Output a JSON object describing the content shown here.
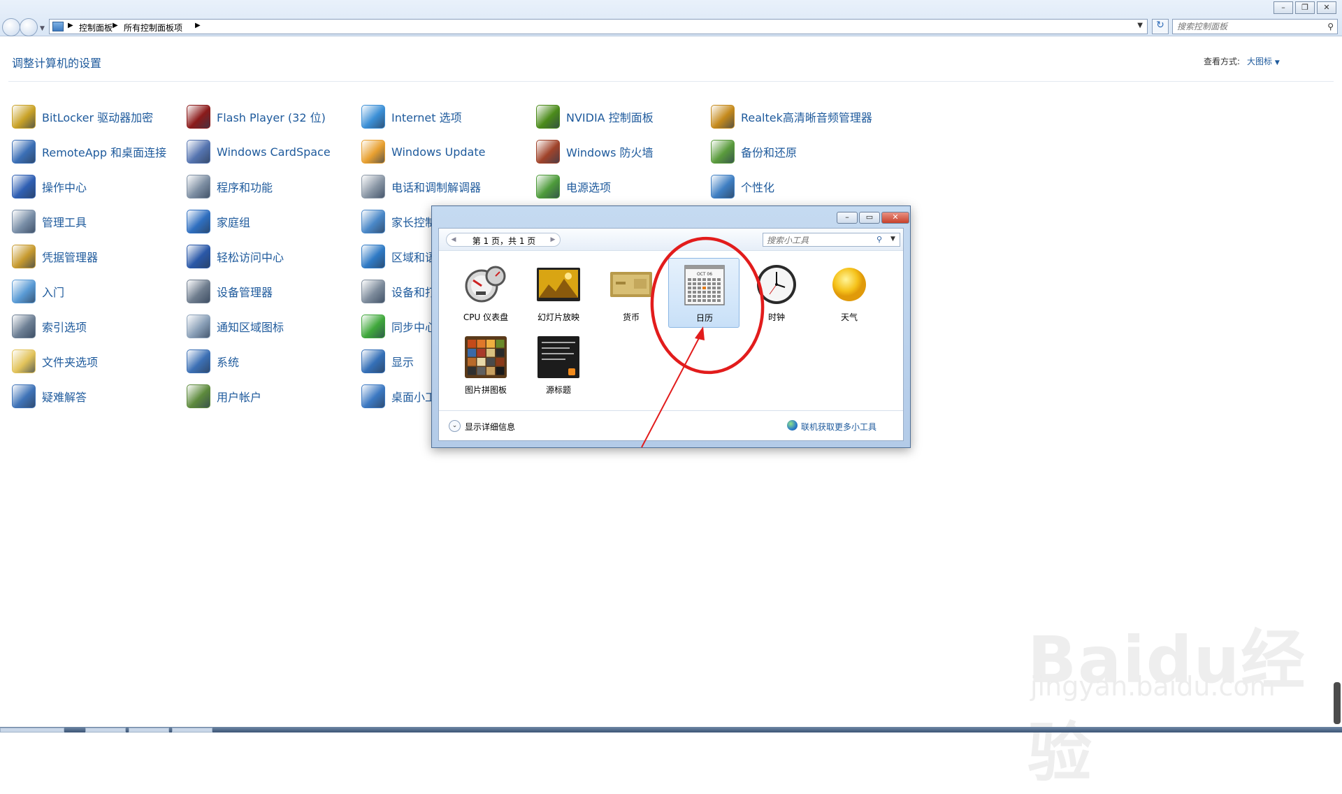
{
  "address_bar": {
    "breadcrumb": [
      "控制面板",
      "所有控制面板项"
    ],
    "search_placeholder": "搜索控制面板"
  },
  "header": {
    "title": "调整计算机的设置",
    "view_by_label": "查看方式:",
    "view_by_value": "大图标"
  },
  "items": [
    {
      "label": "BitLocker 驱动器加密",
      "icon": "key-icon",
      "color": "#c9a227"
    },
    {
      "label": "RemoteApp 和桌面连接",
      "icon": "remote-desktop-icon",
      "color": "#3b6fb6"
    },
    {
      "label": "操作中心",
      "icon": "flag-icon",
      "color": "#2f5fb3"
    },
    {
      "label": "管理工具",
      "icon": "admin-tools-icon",
      "color": "#7a8fa8"
    },
    {
      "label": "凭据管理器",
      "icon": "vault-icon",
      "color": "#c79a2e"
    },
    {
      "label": "入门",
      "icon": "getting-started-icon",
      "color": "#5a9bd5"
    },
    {
      "label": "索引选项",
      "icon": "magnifier-icon",
      "color": "#6d7f94"
    },
    {
      "label": "文件夹选项",
      "icon": "folder-icon",
      "color": "#e2c35a"
    },
    {
      "label": "疑难解答",
      "icon": "troubleshoot-icon",
      "color": "#3f73b8"
    },
    {
      "label": "Flash Player (32 位)",
      "icon": "flash-icon",
      "color": "#8b1a1a"
    },
    {
      "label": "Windows CardSpace",
      "icon": "cardspace-icon",
      "color": "#5574b0"
    },
    {
      "label": "程序和功能",
      "icon": "programs-icon",
      "color": "#7e8fa3"
    },
    {
      "label": "家庭组",
      "icon": "homegroup-icon",
      "color": "#2f6fc0"
    },
    {
      "label": "轻松访问中心",
      "icon": "accessibility-icon",
      "color": "#2a58a8"
    },
    {
      "label": "设备管理器",
      "icon": "device-manager-icon",
      "color": "#6f7d8e"
    },
    {
      "label": "通知区域图标",
      "icon": "tray-icon",
      "color": "#8aa0b8"
    },
    {
      "label": "系统",
      "icon": "system-icon",
      "color": "#3c70b5"
    },
    {
      "label": "用户帐户",
      "icon": "users-icon",
      "color": "#5d8a3c"
    },
    {
      "label": "Internet 选项",
      "icon": "internet-icon",
      "color": "#3b8fd6"
    },
    {
      "label": "Windows Update",
      "icon": "windows-update-icon",
      "color": "#e8a030"
    },
    {
      "label": "电话和调制解调器",
      "icon": "phone-icon",
      "color": "#8a97a6"
    },
    {
      "label": "家长控制",
      "icon": "parental-icon",
      "color": "#4a88c8"
    },
    {
      "label": "区域和语言",
      "icon": "region-icon",
      "color": "#2f7ac5"
    },
    {
      "label": "设备和打印机",
      "icon": "printer-icon",
      "color": "#7e8c9c"
    },
    {
      "label": "同步中心",
      "icon": "sync-icon",
      "color": "#3fa83b"
    },
    {
      "label": "显示",
      "icon": "display-icon",
      "color": "#3570b8"
    },
    {
      "label": "桌面小工具",
      "icon": "gadgets-icon",
      "color": "#3b78c2"
    },
    {
      "label": "NVIDIA 控制面板",
      "icon": "nvidia-icon",
      "color": "#4b8b1a"
    },
    {
      "label": "Windows 防火墙",
      "icon": "firewall-icon",
      "color": "#a0432a"
    },
    {
      "label": "电源选项",
      "icon": "power-icon",
      "color": "#4d9b3a"
    },
    {
      "label": "Realtek高清晰音频管理器",
      "icon": "audio-icon",
      "color": "#c58a1c"
    },
    {
      "label": "备份和还原",
      "icon": "backup-icon",
      "color": "#5a9b3c"
    },
    {
      "label": "个性化",
      "icon": "personalize-icon",
      "color": "#3f7fc3"
    }
  ],
  "gadgets_dialog": {
    "pager_text": "第 1 页，共 1 页",
    "search_placeholder": "搜索小工具",
    "gadgets": [
      {
        "label": "CPU 仪表盘",
        "icon": "cpu-meter-icon"
      },
      {
        "label": "幻灯片放映",
        "icon": "slideshow-icon"
      },
      {
        "label": "货币",
        "icon": "currency-icon"
      },
      {
        "label": "日历",
        "icon": "calendar-icon",
        "selected": true
      },
      {
        "label": "时钟",
        "icon": "clock-icon"
      },
      {
        "label": "天气",
        "icon": "weather-icon"
      },
      {
        "label": "图片拼图板",
        "icon": "puzzle-icon"
      },
      {
        "label": "源标题",
        "icon": "feed-headlines-icon"
      }
    ],
    "details_label": "显示详细信息",
    "online_link": "联机获取更多小工具",
    "calendar_month": "OCT 06"
  },
  "watermark": {
    "brand": "Baidu经验",
    "url": "jingyan.baidu.com"
  }
}
